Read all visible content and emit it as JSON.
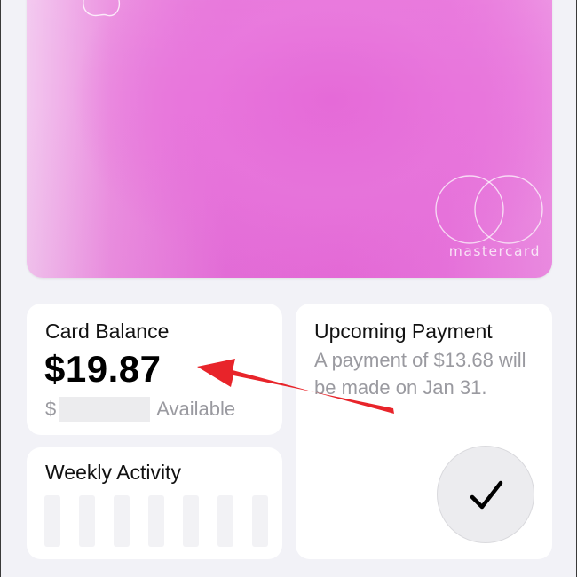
{
  "card": {
    "network_label": "mastercard",
    "apple_logo_icon": "apple-logo-icon",
    "mastercard_icon": "mastercard-circles-icon"
  },
  "balance_tile": {
    "title": "Card Balance",
    "amount": "$19.87",
    "currency_symbol": "$",
    "available_label": "Available"
  },
  "payment_tile": {
    "title": "Upcoming Payment",
    "description": "A payment of $13.68 will be made on Jan 31.",
    "button_icon": "checkmark-icon"
  },
  "activity_tile": {
    "title": "Weekly Activity",
    "bar_count": 7
  },
  "annotation": {
    "arrow_color": "#e8242a"
  },
  "colors": {
    "background": "#f2f2f7",
    "card_pink": "#e66bd8",
    "secondary_text": "#9a9aa0"
  }
}
